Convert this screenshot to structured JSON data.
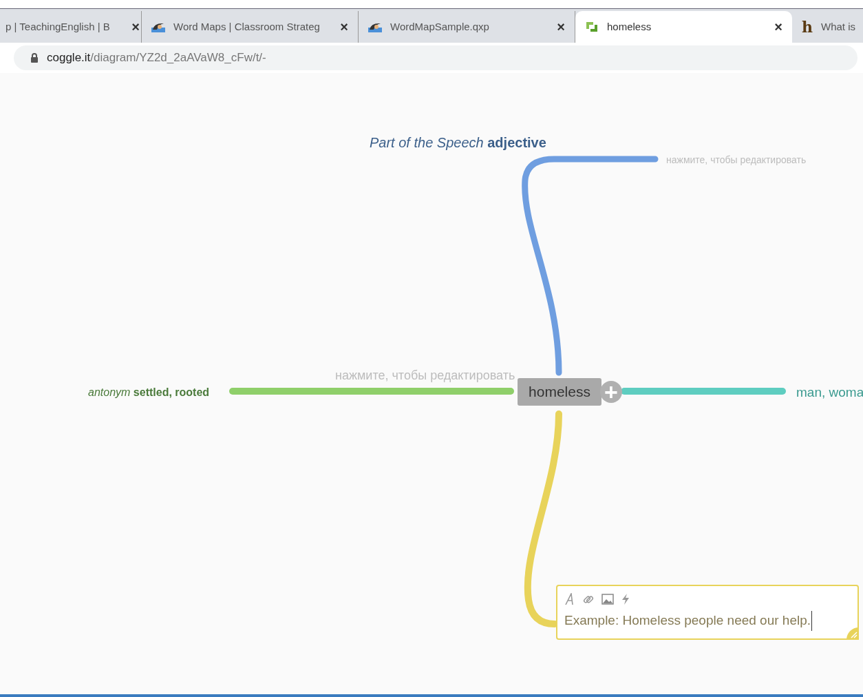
{
  "browser": {
    "tabs": [
      {
        "title": "p | TeachingEnglish | B",
        "selected": false,
        "close": "×"
      },
      {
        "title": "Word Maps | Classroom Strateg",
        "selected": false,
        "close": "×"
      },
      {
        "title": "WordMapSample.qxp",
        "selected": false,
        "close": "×"
      },
      {
        "title": "homeless",
        "selected": true,
        "close": "×"
      },
      {
        "title": "What is",
        "glyph": "h",
        "selected": false
      }
    ],
    "address": {
      "host": "coggle.it",
      "path": "/diagram/YZ2d_2aAVaW8_cFw/t/-"
    }
  },
  "map": {
    "central": {
      "label": "homeless",
      "add": "+"
    },
    "branches": [
      {
        "color": "#6f9ee0",
        "nodes": [
          {
            "kind": "label",
            "text": "*Part of the Speech* **adjective**"
          },
          {
            "kind": "placeholder",
            "text": "нажмите, чтобы редактировать"
          }
        ]
      },
      {
        "color": "#8fcf6a",
        "nodes": [
          {
            "kind": "placeholder",
            "text": "нажмите, чтобы редактировать"
          },
          {
            "kind": "label",
            "text": "*antonym* **settled, rooted**"
          }
        ]
      },
      {
        "color": "#5ecdc0",
        "nodes": [
          {
            "kind": "label",
            "text": "man, woma"
          }
        ]
      },
      {
        "color": "#e8d35a",
        "nodes": [
          {
            "kind": "editing",
            "text": "Example: Homeless people need our help."
          }
        ]
      }
    ]
  }
}
